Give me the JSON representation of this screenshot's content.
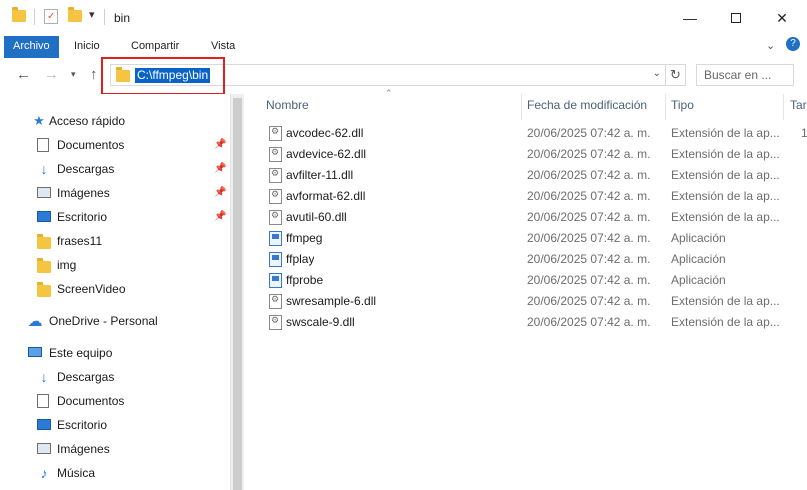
{
  "window": {
    "title": "bin",
    "controls": [
      "minimize-icon",
      "maximize-icon",
      "close-icon"
    ]
  },
  "ribbon": {
    "tabs": [
      "Archivo",
      "Inicio",
      "Compartir",
      "Vista"
    ]
  },
  "address": {
    "path": "C:\\ffmpeg\\bin"
  },
  "search": {
    "placeholder": "Buscar en ..."
  },
  "nav": {
    "quick_access": "Acceso rápido",
    "items": [
      {
        "label": "Documentos",
        "icon": "documents-icon",
        "pinned": true
      },
      {
        "label": "Descargas",
        "icon": "download-icon",
        "pinned": true
      },
      {
        "label": "Imágenes",
        "icon": "pictures-icon",
        "pinned": true
      },
      {
        "label": "Escritorio",
        "icon": "desktop-icon",
        "pinned": true
      },
      {
        "label": "frases11",
        "icon": "folder-icon",
        "pinned": false
      },
      {
        "label": "img",
        "icon": "folder-icon",
        "pinned": false
      },
      {
        "label": "ScreenVideo",
        "icon": "folder-icon",
        "pinned": false
      }
    ],
    "onedrive": "OneDrive - Personal",
    "this_pc": "Este equipo",
    "pc_items": [
      {
        "label": "Descargas",
        "icon": "download-icon"
      },
      {
        "label": "Documentos",
        "icon": "documents-icon"
      },
      {
        "label": "Escritorio",
        "icon": "desktop-icon"
      },
      {
        "label": "Imágenes",
        "icon": "pictures-icon"
      },
      {
        "label": "Música",
        "icon": "music-icon"
      }
    ]
  },
  "columns": {
    "name": "Nombre",
    "date": "Fecha de modificación",
    "type": "Tipo",
    "size": "Tar"
  },
  "files": [
    {
      "name": "avcodec-62.dll",
      "date": "20/06/2025 07:42 a. m.",
      "type": "Extensión de la ap...",
      "size": "1",
      "kind": "dll"
    },
    {
      "name": "avdevice-62.dll",
      "date": "20/06/2025 07:42 a. m.",
      "type": "Extensión de la ap...",
      "size": "",
      "kind": "dll"
    },
    {
      "name": "avfilter-11.dll",
      "date": "20/06/2025 07:42 a. m.",
      "type": "Extensión de la ap...",
      "size": "",
      "kind": "dll"
    },
    {
      "name": "avformat-62.dll",
      "date": "20/06/2025 07:42 a. m.",
      "type": "Extensión de la ap...",
      "size": "",
      "kind": "dll"
    },
    {
      "name": "avutil-60.dll",
      "date": "20/06/2025 07:42 a. m.",
      "type": "Extensión de la ap...",
      "size": "",
      "kind": "dll"
    },
    {
      "name": "ffmpeg",
      "date": "20/06/2025 07:42 a. m.",
      "type": "Aplicación",
      "size": "",
      "kind": "exe"
    },
    {
      "name": "ffplay",
      "date": "20/06/2025 07:42 a. m.",
      "type": "Aplicación",
      "size": "",
      "kind": "exe"
    },
    {
      "name": "ffprobe",
      "date": "20/06/2025 07:42 a. m.",
      "type": "Aplicación",
      "size": "",
      "kind": "exe"
    },
    {
      "name": "swresample-6.dll",
      "date": "20/06/2025 07:42 a. m.",
      "type": "Extensión de la ap...",
      "size": "",
      "kind": "dll"
    },
    {
      "name": "swscale-9.dll",
      "date": "20/06/2025 07:42 a. m.",
      "type": "Extensión de la ap...",
      "size": "",
      "kind": "dll"
    }
  ],
  "colors": {
    "accent": "#1f6fc4",
    "selection": "#0a64c8",
    "highlight_box": "#e02020",
    "folder": "#f5c542"
  }
}
